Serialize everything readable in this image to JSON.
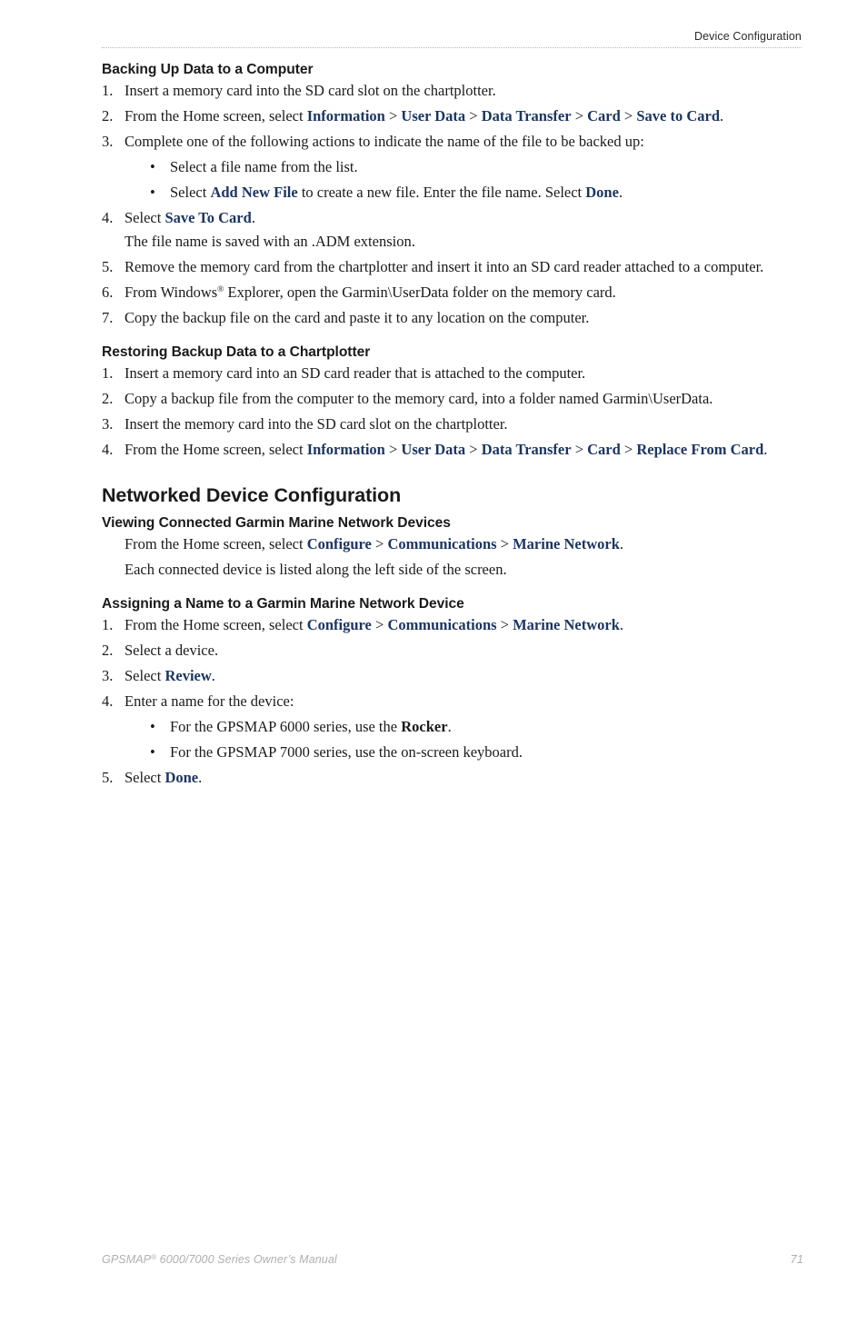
{
  "header": {
    "title": "Device Configuration"
  },
  "sections": [
    {
      "id": "backing-up",
      "heading": "Backing Up Data to a Computer",
      "steps": [
        {
          "num": "1.",
          "parts": [
            {
              "t": "text",
              "v": "Insert a memory card into the SD card slot on the chartplotter."
            }
          ]
        },
        {
          "num": "2.",
          "parts": [
            {
              "t": "text",
              "v": "From the Home screen, select "
            },
            {
              "t": "ui",
              "v": "Information"
            },
            {
              "t": "sep",
              "v": " > "
            },
            {
              "t": "ui",
              "v": "User Data"
            },
            {
              "t": "sep",
              "v": " > "
            },
            {
              "t": "ui",
              "v": "Data Transfer"
            },
            {
              "t": "sep",
              "v": " > "
            },
            {
              "t": "ui",
              "v": "Card"
            },
            {
              "t": "sep",
              "v": " > "
            },
            {
              "t": "ui",
              "v": "Save to Card"
            },
            {
              "t": "text",
              "v": "."
            }
          ]
        },
        {
          "num": "3.",
          "parts": [
            {
              "t": "text",
              "v": "Complete one of the following actions to indicate the name of the file to be backed up:"
            }
          ],
          "bullets": [
            {
              "parts": [
                {
                  "t": "text",
                  "v": "Select a file name from the list."
                }
              ]
            },
            {
              "parts": [
                {
                  "t": "text",
                  "v": "Select "
                },
                {
                  "t": "ui",
                  "v": "Add New File"
                },
                {
                  "t": "text",
                  "v": " to create a new file. Enter the file name. Select "
                },
                {
                  "t": "ui",
                  "v": "Done"
                },
                {
                  "t": "text",
                  "v": "."
                }
              ]
            }
          ]
        },
        {
          "num": "4.",
          "parts": [
            {
              "t": "text",
              "v": "Select "
            },
            {
              "t": "ui",
              "v": "Save To Card"
            },
            {
              "t": "text",
              "v": "."
            }
          ],
          "continuation": [
            {
              "t": "text",
              "v": "The file name is saved with an .ADM extension."
            }
          ]
        },
        {
          "num": "5.",
          "parts": [
            {
              "t": "text",
              "v": "Remove the memory card from the chartplotter and insert it into an SD card reader attached to a computer."
            }
          ]
        },
        {
          "num": "6.",
          "parts": [
            {
              "t": "text",
              "v": "From Windows"
            },
            {
              "t": "reg",
              "v": "®"
            },
            {
              "t": "text",
              "v": " Explorer, open the Garmin\\UserData folder on the memory card."
            }
          ]
        },
        {
          "num": "7.",
          "parts": [
            {
              "t": "text",
              "v": "Copy the backup file on the card and paste it to any location on the computer."
            }
          ]
        }
      ]
    },
    {
      "id": "restoring",
      "heading": "Restoring Backup Data to a Chartplotter",
      "steps": [
        {
          "num": "1.",
          "parts": [
            {
              "t": "text",
              "v": "Insert a memory card into an SD card reader that is attached to the computer."
            }
          ]
        },
        {
          "num": "2.",
          "parts": [
            {
              "t": "text",
              "v": "Copy a backup file from the computer to the memory card, into a folder named Garmin\\UserData."
            }
          ]
        },
        {
          "num": "3.",
          "parts": [
            {
              "t": "text",
              "v": "Insert the memory card into the SD card slot on the chartplotter."
            }
          ]
        },
        {
          "num": "4.",
          "parts": [
            {
              "t": "text",
              "v": "From the Home screen, select "
            },
            {
              "t": "ui",
              "v": "Information"
            },
            {
              "t": "sep",
              "v": " > "
            },
            {
              "t": "ui",
              "v": "User Data"
            },
            {
              "t": "sep",
              "v": " > "
            },
            {
              "t": "ui",
              "v": "Data Transfer"
            },
            {
              "t": "sep",
              "v": " > "
            },
            {
              "t": "ui",
              "v": "Card"
            },
            {
              "t": "sep",
              "v": " > "
            },
            {
              "t": "ui",
              "v": "Replace From Card"
            },
            {
              "t": "text",
              "v": "."
            }
          ]
        }
      ]
    }
  ],
  "chapter": {
    "title": "Networked Device Configuration",
    "subsections": [
      {
        "id": "viewing-devices",
        "heading": "Viewing Connected Garmin Marine Network Devices",
        "paragraphs": [
          [
            {
              "t": "text",
              "v": "From the Home screen, select "
            },
            {
              "t": "ui",
              "v": "Configure"
            },
            {
              "t": "sep",
              "v": " > "
            },
            {
              "t": "ui",
              "v": "Communications"
            },
            {
              "t": "sep",
              "v": " > "
            },
            {
              "t": "ui",
              "v": "Marine Network"
            },
            {
              "t": "text",
              "v": "."
            }
          ],
          [
            {
              "t": "text",
              "v": "Each connected device is listed along the left side of the screen."
            }
          ]
        ]
      },
      {
        "id": "assigning-name",
        "heading": "Assigning a Name to a Garmin Marine Network Device",
        "steps": [
          {
            "num": "1.",
            "parts": [
              {
                "t": "text",
                "v": "From the Home screen, select "
              },
              {
                "t": "ui",
                "v": "Configure"
              },
              {
                "t": "sep",
                "v": " > "
              },
              {
                "t": "ui",
                "v": "Communications"
              },
              {
                "t": "sep",
                "v": " > "
              },
              {
                "t": "ui",
                "v": "Marine Network"
              },
              {
                "t": "text",
                "v": "."
              }
            ]
          },
          {
            "num": "2.",
            "parts": [
              {
                "t": "text",
                "v": "Select a device."
              }
            ]
          },
          {
            "num": "3.",
            "parts": [
              {
                "t": "text",
                "v": "Select "
              },
              {
                "t": "ui",
                "v": "Review"
              },
              {
                "t": "text",
                "v": "."
              }
            ]
          },
          {
            "num": "4.",
            "parts": [
              {
                "t": "text",
                "v": "Enter a name for the device:"
              }
            ],
            "bullets": [
              {
                "parts": [
                  {
                    "t": "text",
                    "v": "For the GPSMAP 6000 series, use the "
                  },
                  {
                    "t": "kb",
                    "v": "Rocker"
                  },
                  {
                    "t": "text",
                    "v": "."
                  }
                ]
              },
              {
                "parts": [
                  {
                    "t": "text",
                    "v": "For the GPSMAP 7000 series, use the on-screen keyboard."
                  }
                ]
              }
            ]
          },
          {
            "num": "5.",
            "parts": [
              {
                "t": "text",
                "v": "Select "
              },
              {
                "t": "ui",
                "v": "Done"
              },
              {
                "t": "text",
                "v": "."
              }
            ]
          }
        ]
      }
    ]
  },
  "footer": {
    "manual_pre": "GPSMAP",
    "manual_reg": "®",
    "manual_post": " 6000/7000 Series Owner’s Manual",
    "page_number": "71"
  },
  "colors": {
    "ui_term_blue": "#1d3661",
    "body_text": "#1a1a1a",
    "footer_gray": "#b0b0b0",
    "rule_gray": "#b8b8b8"
  }
}
